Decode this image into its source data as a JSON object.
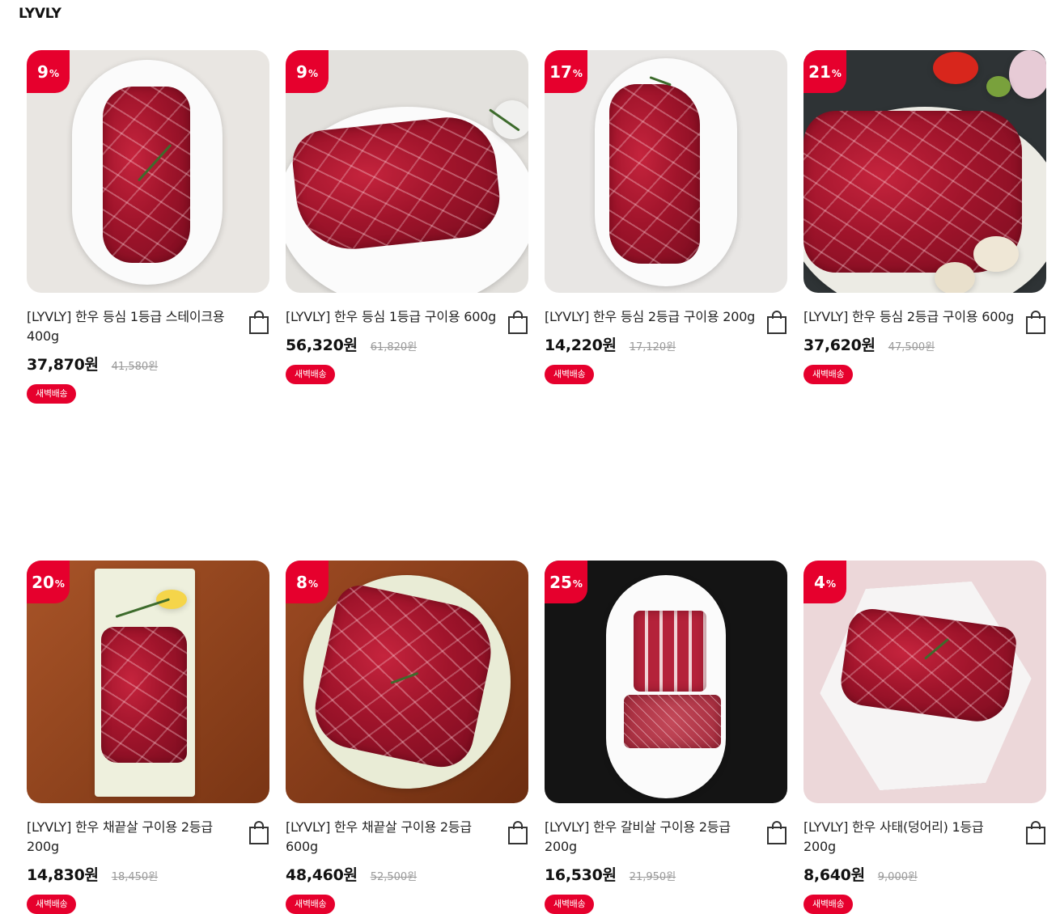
{
  "brand": "LYVLY",
  "colors": {
    "accent": "#e6002d",
    "text": "#222222",
    "muted": "#999999"
  },
  "products": [
    {
      "discount": "9",
      "pct": "%",
      "title": "[LYVLY] 한우 등심 1등급 스테이크용 400g",
      "price": "37,870원",
      "original_price": "41,580원",
      "badge": "새벽배송",
      "cart_icon": "shopping-bag-icon"
    },
    {
      "discount": "9",
      "pct": "%",
      "title": "[LYVLY] 한우 등심 1등급 구이용 600g",
      "price": "56,320원",
      "original_price": "61,820원",
      "badge": "새벽배송",
      "cart_icon": "shopping-bag-icon"
    },
    {
      "discount": "17",
      "pct": "%",
      "title": "[LYVLY] 한우 등심 2등급 구이용 200g",
      "price": "14,220원",
      "original_price": "17,120원",
      "badge": "새벽배송",
      "cart_icon": "shopping-bag-icon"
    },
    {
      "discount": "21",
      "pct": "%",
      "title": "[LYVLY] 한우 등심 2등급 구이용 600g",
      "price": "37,620원",
      "original_price": "47,500원",
      "badge": "새벽배송",
      "cart_icon": "shopping-bag-icon"
    },
    {
      "discount": "20",
      "pct": "%",
      "title": "[LYVLY] 한우 채끝살 구이용 2등급 200g",
      "price": "14,830원",
      "original_price": "18,450원",
      "badge": "새벽배송",
      "cart_icon": "shopping-bag-icon"
    },
    {
      "discount": "8",
      "pct": "%",
      "title": "[LYVLY] 한우 채끝살 구이용 2등급 600g",
      "price": "48,460원",
      "original_price": "52,500원",
      "badge": "새벽배송",
      "cart_icon": "shopping-bag-icon"
    },
    {
      "discount": "25",
      "pct": "%",
      "title": "[LYVLY] 한우 갈비살 구이용 2등급 200g",
      "price": "16,530원",
      "original_price": "21,950원",
      "badge": "새벽배송",
      "cart_icon": "shopping-bag-icon"
    },
    {
      "discount": "4",
      "pct": "%",
      "title": "[LYVLY] 한우 사태(덩어리) 1등급 200g",
      "price": "8,640원",
      "original_price": "9,000원",
      "badge": "새벽배송",
      "cart_icon": "shopping-bag-icon"
    }
  ]
}
